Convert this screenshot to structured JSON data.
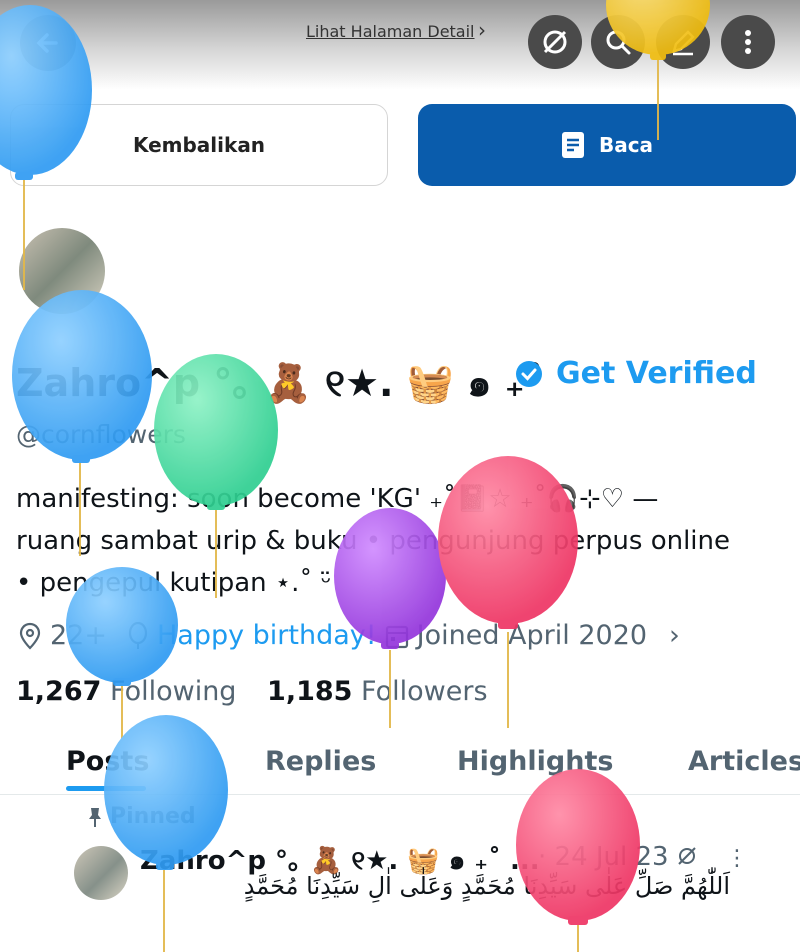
{
  "header": {
    "detail_link": "Lihat Halaman Detail",
    "detail_chevron": "›"
  },
  "actions": {
    "return_label": "Kembalikan",
    "read_label": "Baca"
  },
  "profile": {
    "display_name": "Zahro^p °｡ 🧸 ୧★. 🧺 ๑ ₊˚",
    "get_verified": "Get Verified",
    "handle": "@cornflowers",
    "bio_line1": "manifesting: soon become 'KG' ₊˚📓☆ ₊˚🎧⊹♡ —",
    "bio_line2": "ruang sambat urip & buku • pengunjung perpus online",
    "bio_line3": "• pengepul kutipan ⋆.˚ ᵕ̈",
    "age": "22+",
    "birthday": "Happy birthday!",
    "joined": "Joined April 2020",
    "following_count": "1,267",
    "following_label": "Following",
    "followers_count": "1,185",
    "followers_label": "Followers"
  },
  "tabs": [
    "Posts",
    "Replies",
    "Highlights",
    "Articles"
  ],
  "post": {
    "pinned_label": "Pinned",
    "author": "Zahro^p °｡ 🧸 ୧★. 🧺 ๑ ₊˚ ...",
    "date": "· 24 Jul 23",
    "text": "اَللّٰهُمَّ صَلِّ عَلٰى سَيِّدِنَا مُحَمَّدٍ وَعَلٰى اٰلِ سَيِّدِنَا مُحَمَّدٍ"
  },
  "colors": {
    "accent": "#1d9bf0",
    "read_button": "#0a5cac",
    "balloon_blue": "#2f9bf2",
    "balloon_green": "#36d69a",
    "balloon_purple": "#9f3fe0",
    "balloon_pink": "#f0406a",
    "balloon_yellow": "#f2c21a"
  },
  "icons": [
    "back-arrow-icon",
    "hide-icon",
    "search-icon",
    "edit-icon",
    "more-icon",
    "document-icon",
    "verified-badge-icon",
    "location-icon",
    "balloon-icon",
    "calendar-icon",
    "pin-icon",
    "grok-icon"
  ]
}
